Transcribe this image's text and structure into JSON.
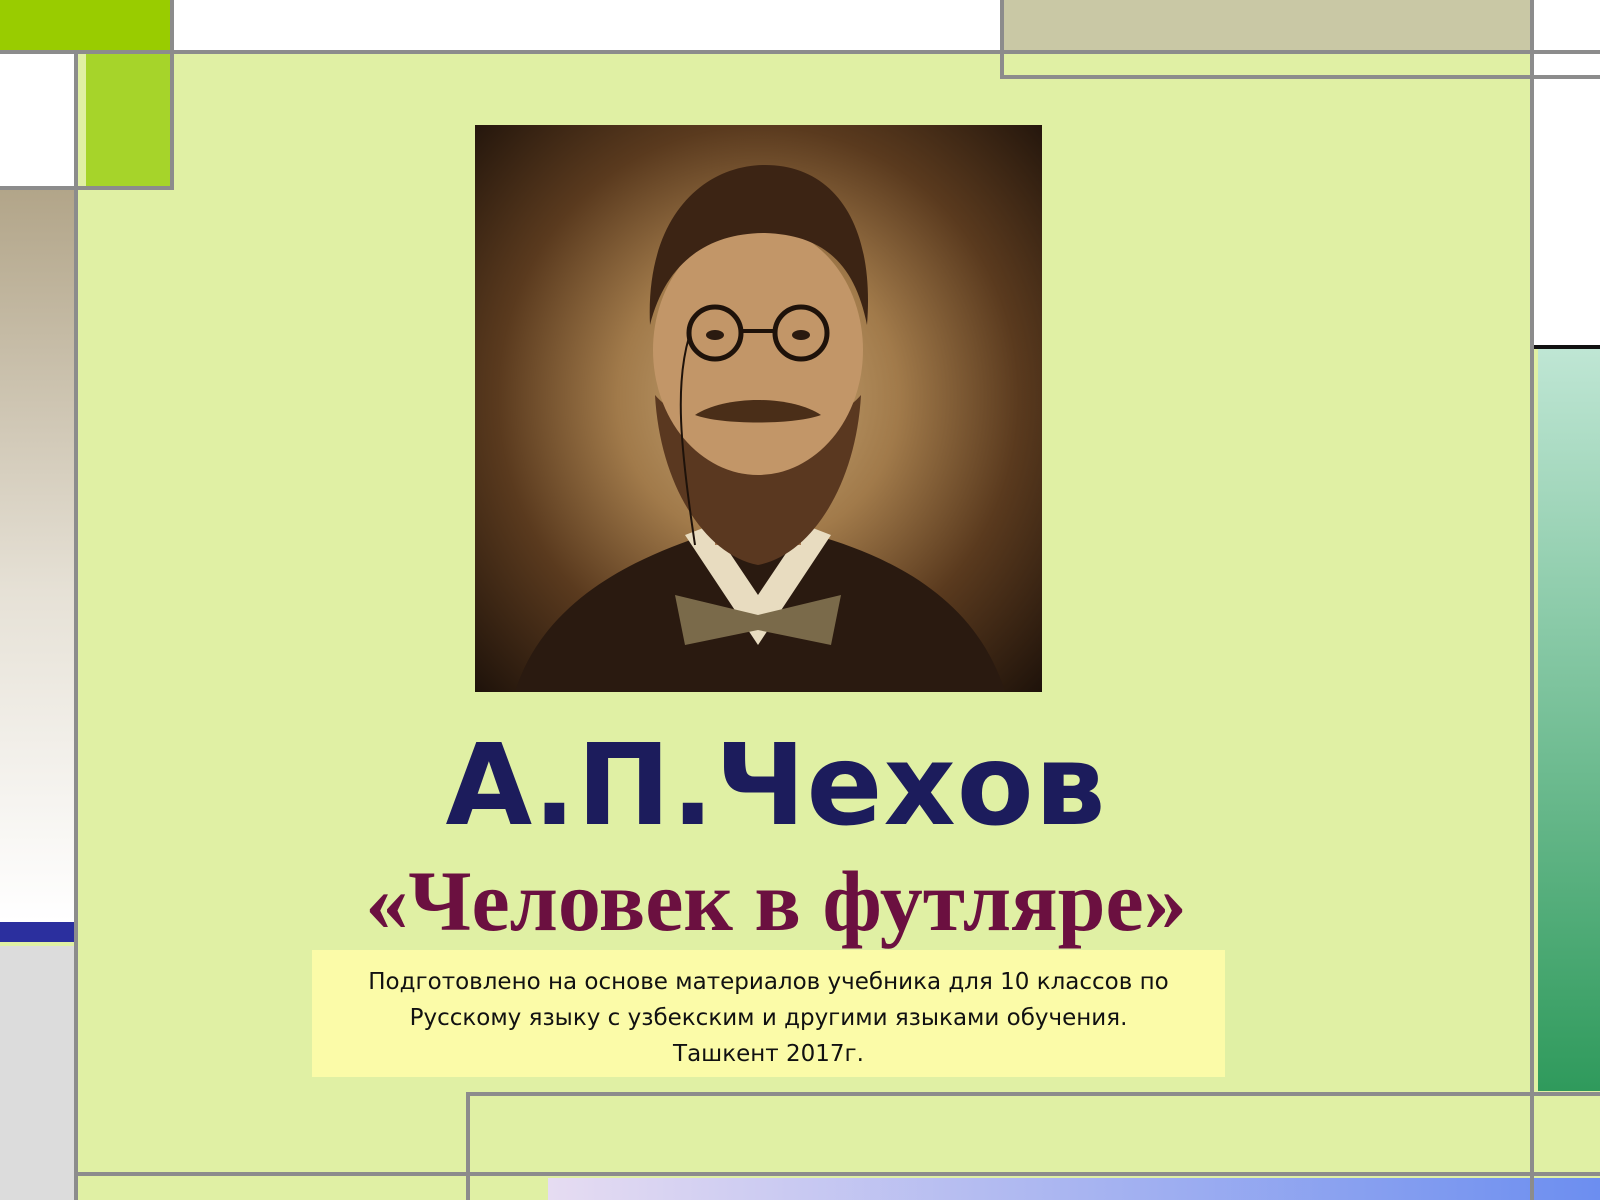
{
  "slide": {
    "title": "А.П.Чехов",
    "subtitle": "«Человек в футляре»",
    "note_lines": [
      "Подготовлено на основе материалов учебника для 10 классов по",
      "Русскому языку с узбекским и другими языками обучения.",
      "Ташкент 2017г."
    ]
  },
  "colors": {
    "background": "#e0f0a4",
    "title": "#1c1c5c",
    "subtitle": "#6b1040",
    "note_bg": "#fbfba8",
    "accent_green": "#9ccc00",
    "accent_blue": "#2b2f9e",
    "frame_lines": "#8c8c8c"
  }
}
